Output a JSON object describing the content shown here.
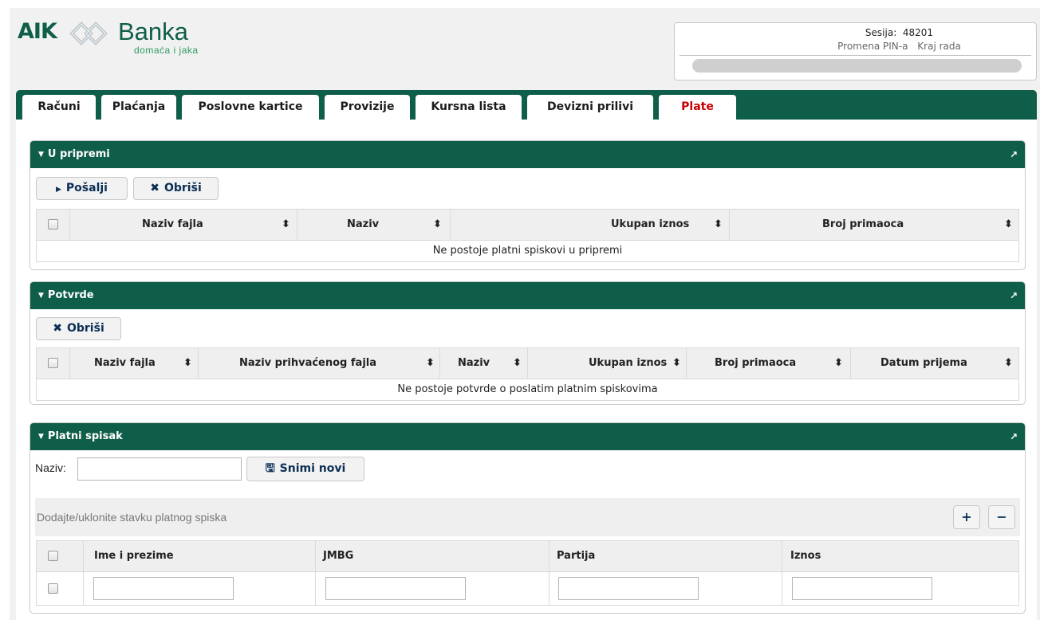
{
  "logo": {
    "brand_left": "AIK",
    "brand_right": "Banka",
    "tagline": "domaća i jaka"
  },
  "session": {
    "label": "Sesija:",
    "id": "48201",
    "change_pin": "Promena PIN-a",
    "logout": "Kraj rada"
  },
  "tabs": [
    {
      "label": "Računi"
    },
    {
      "label": "Plaćanja"
    },
    {
      "label": "Poslovne kartice"
    },
    {
      "label": "Provizije"
    },
    {
      "label": "Kursna lista"
    },
    {
      "label": "Devizni prilivi"
    },
    {
      "label": "Plate",
      "active": true
    }
  ],
  "u_pripremi": {
    "title": "U pripremi",
    "send_button": "Pošalji",
    "delete_button": "Obriši",
    "columns": [
      "Naziv fajla",
      "Naziv",
      "Ukupan iznos",
      "Broj primaoca"
    ],
    "empty_message": "Ne postoje platni spiskovi u pripremi"
  },
  "potvrde": {
    "title": "Potvrde",
    "delete_button": "Obriši",
    "columns": [
      "Naziv fajla",
      "Naziv prihvaćenog fajla",
      "Naziv",
      "Ukupan iznos",
      "Broj primaoca",
      "Datum prijema"
    ],
    "empty_message": "Ne postoje potvrde o poslatim platnim spiskovima"
  },
  "platni_spisak": {
    "title": "Platni spisak",
    "name_label": "Naziv:",
    "name_value": "",
    "save_button": "Snimi novi",
    "add_remove_label": "Dodajte/uklonite stavku platnog spiska",
    "add_symbol": "+",
    "remove_symbol": "−",
    "columns": [
      "Ime i prezime",
      "JMBG",
      "Partija",
      "Iznos"
    ],
    "row": {
      "ime": "",
      "jmbg": "",
      "partija": "",
      "iznos": ""
    }
  },
  "icons": {
    "collapse": "caret-down-icon",
    "expand": "expand-arrow-icon",
    "send": "play-triangle-icon",
    "delete": "x-mark-icon",
    "save": "floppy-disk-icon",
    "sort": "sort-icon"
  },
  "colors": {
    "brand_green": "#0f5e49",
    "active_tab_text": "#c80000",
    "button_text": "#0b2f55"
  }
}
